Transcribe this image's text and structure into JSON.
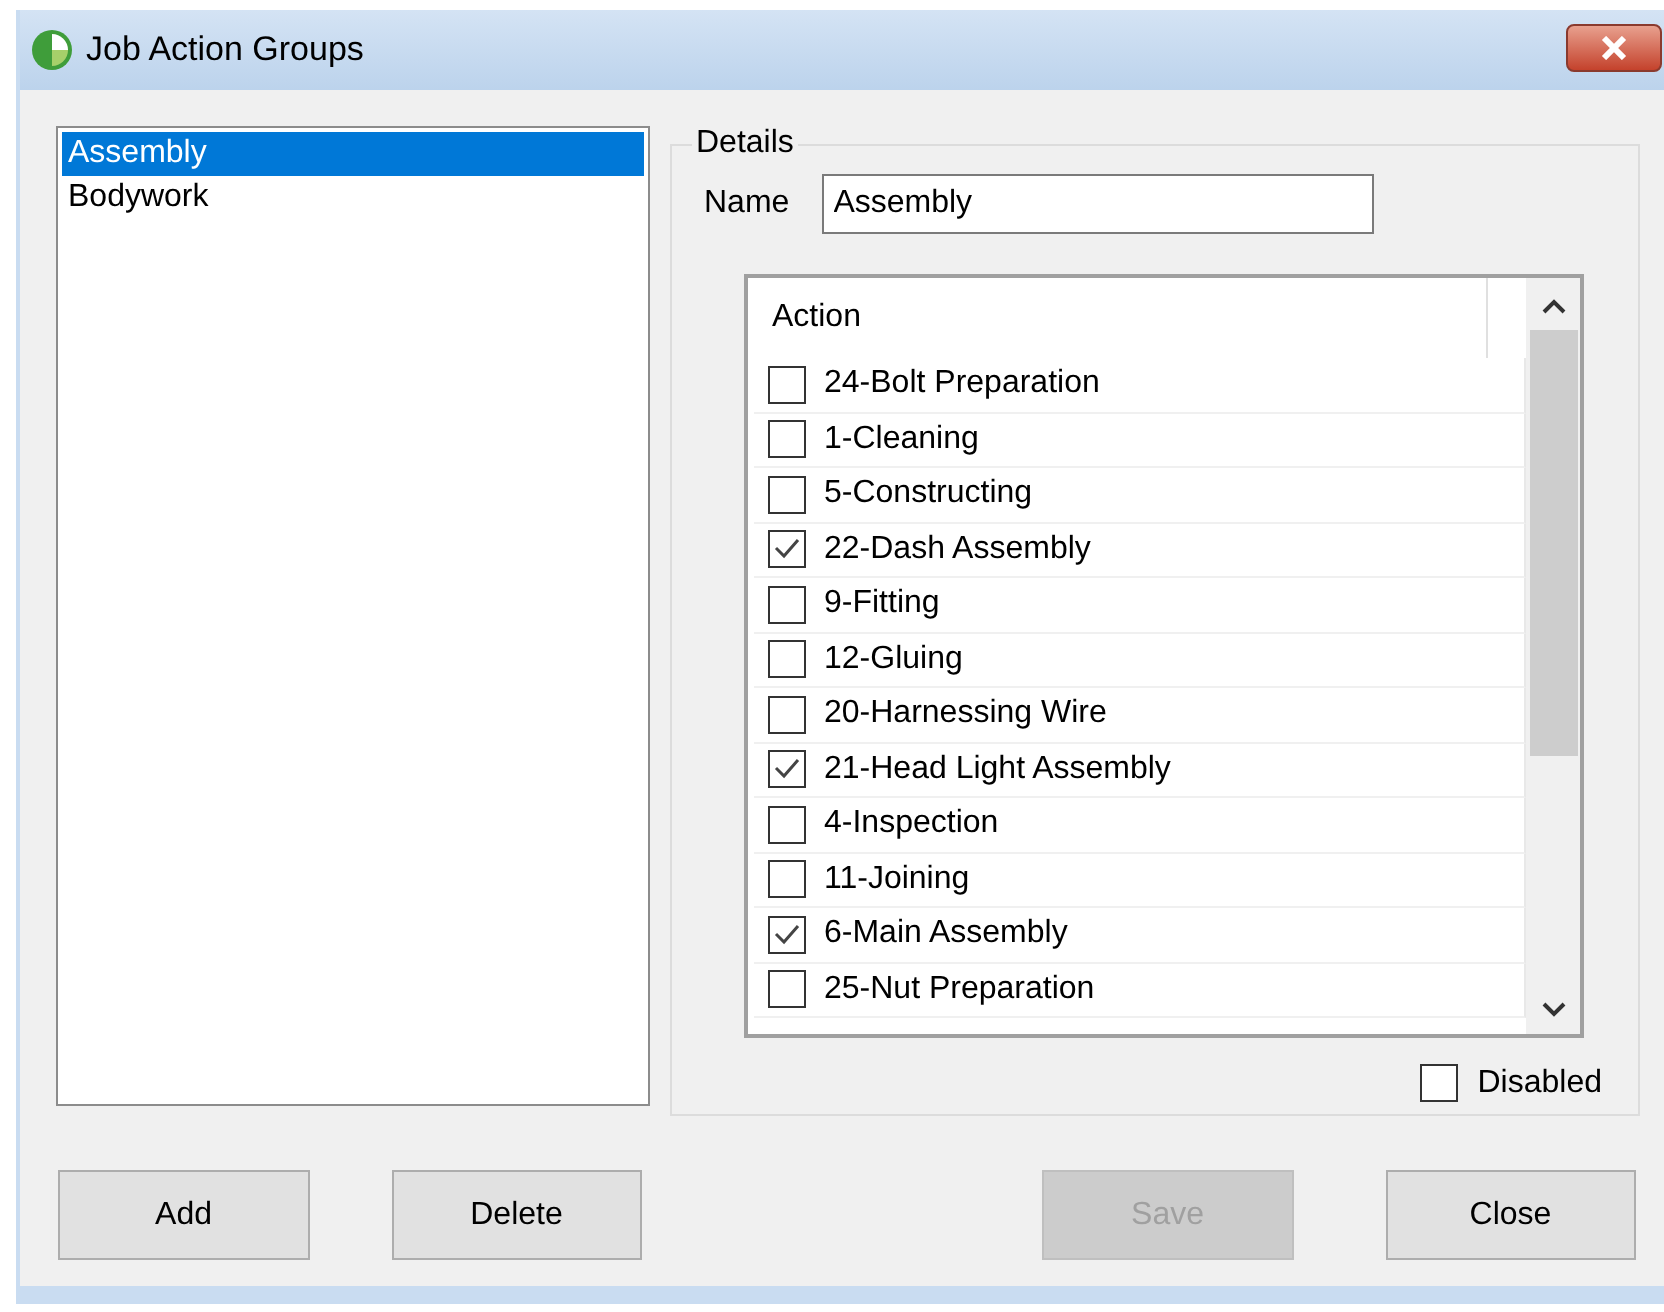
{
  "window": {
    "title": "Job Action Groups"
  },
  "groups": [
    {
      "label": "Assembly",
      "selected": true
    },
    {
      "label": "Bodywork",
      "selected": false
    }
  ],
  "details": {
    "legend": "Details",
    "name_label": "Name",
    "name_value": "Assembly",
    "column_header": "Action",
    "actions": [
      {
        "label": "24-Bolt Preparation",
        "checked": false
      },
      {
        "label": "1-Cleaning",
        "checked": false
      },
      {
        "label": "5-Constructing",
        "checked": false
      },
      {
        "label": "22-Dash Assembly",
        "checked": true
      },
      {
        "label": "9-Fitting",
        "checked": false
      },
      {
        "label": "12-Gluing",
        "checked": false
      },
      {
        "label": "20-Harnessing Wire",
        "checked": false
      },
      {
        "label": "21-Head Light Assembly",
        "checked": true
      },
      {
        "label": "4-Inspection",
        "checked": false
      },
      {
        "label": "11-Joining",
        "checked": false
      },
      {
        "label": "6-Main Assembly",
        "checked": true
      },
      {
        "label": "25-Nut Preparation",
        "checked": false
      }
    ],
    "disabled": {
      "label": "Disabled",
      "checked": false
    }
  },
  "buttons": [
    {
      "label": "Add",
      "disabled": false
    },
    {
      "label": "Delete",
      "disabled": false
    },
    {
      "label": "Save",
      "disabled": true
    },
    {
      "label": "Close",
      "disabled": false
    }
  ]
}
